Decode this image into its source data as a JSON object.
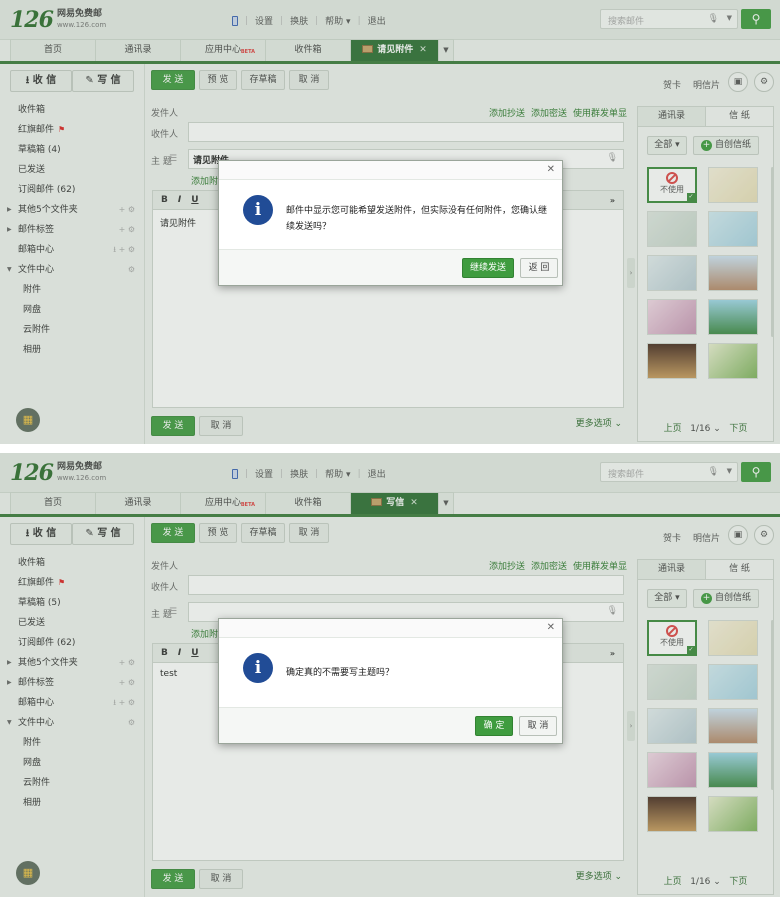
{
  "app": {
    "logo_number": "126",
    "logo_name": "网易免费邮",
    "logo_url": "www.126.com"
  },
  "top_links": [
    "设置",
    "换肤",
    "帮助",
    "退出"
  ],
  "search": {
    "placeholder": "搜索邮件"
  },
  "tabs": [
    "首页",
    "通讯录",
    "应用中心",
    "收件箱"
  ],
  "tab_beta": "BETA",
  "sidebar": {
    "receive": "收 信",
    "write": "写 信",
    "folders": [
      {
        "label": "收件箱"
      },
      {
        "label": "红旗邮件"
      },
      {
        "label": "草稿箱"
      },
      {
        "label": "已发送"
      },
      {
        "label": "订阅邮件"
      },
      {
        "label": "其他5个文件夹"
      },
      {
        "label": "邮件标签"
      },
      {
        "label": "邮箱中心"
      },
      {
        "label": "文件中心"
      },
      {
        "label": "附件"
      },
      {
        "label": "网盘"
      },
      {
        "label": "云附件"
      },
      {
        "label": "相册"
      }
    ]
  },
  "toolbar": {
    "send": "发 送",
    "preview": "预 览",
    "save_draft": "存草稿",
    "cancel": "取 消"
  },
  "form": {
    "sender_label": "发件人",
    "recipient_label": "收件人",
    "subject_label": "主 题",
    "add_cc": "添加抄送",
    "add_bcc": "添加密送",
    "group_send": "使用群发单显",
    "add_attachment": "添加附"
  },
  "format_buttons": [
    "B",
    "I",
    "U"
  ],
  "more_options": "更多选项",
  "right": {
    "greeting_card": "贺卡",
    "postcard": "明信片",
    "tab_contacts": "通讯录",
    "tab_stationery": "信 纸",
    "all_btn": "全部",
    "custom_btn": "自创信纸",
    "no_use": "不使用",
    "prev": "上页",
    "page": "1/16",
    "next": "下页"
  },
  "screens": [
    {
      "active_tab": "请见附件",
      "draft_label": "草稿箱 (4)",
      "subscribe_label": "订阅邮件 (62)",
      "subject": "请见附件",
      "body": "请见附件",
      "dialog": {
        "message": "邮件中显示您可能希望发送附件，但实际没有任何附件，您确认继续发送吗？",
        "ok": "继续发送",
        "cancel": "返 回"
      }
    },
    {
      "active_tab": "写信",
      "draft_label": "草稿箱 (5)",
      "subscribe_label": "订阅邮件 (62)",
      "subject": "",
      "body": "test",
      "dialog": {
        "message": "确定真的不需要写主题吗？",
        "ok": "确 定",
        "cancel": "取 消"
      }
    }
  ],
  "colors": {
    "brand_green": "#2d6e33",
    "button_green": "#3f9a3f",
    "info_blue": "#214c96"
  }
}
